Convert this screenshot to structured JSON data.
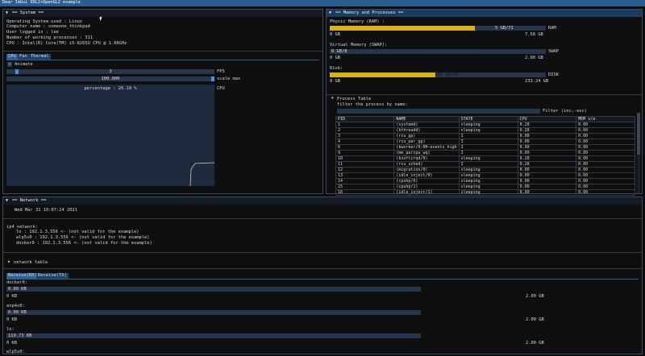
{
  "window_title": "Dear ImGui SDL2+OpenGL2 example",
  "system": {
    "header": "== System ==",
    "lines": [
      "Operating System used : Linux",
      "Computer name : someone_thinkpad",
      "User logged in : lee",
      "Number of working processes : 311",
      "CPU : Intel(R) Core(TM) i5-8265U CPU @ 1.60GHz"
    ],
    "tabs": [
      "CPU",
      "Fan",
      "Thermal"
    ],
    "animate_label": "Animate",
    "animate_checked": true,
    "fps_label": "FPS",
    "fps_value": "3",
    "scale_label": "scale max",
    "scale_value": "100.000",
    "plot_overlay": "percentage : 26.19 %",
    "plot_label": "CPU"
  },
  "memory": {
    "header": "== Memory and Processes ==",
    "ram": {
      "title": "Physic Memory (RAM) :",
      "bar_text": "5 GB/7I",
      "fraction": 0.67,
      "tag": "RAM",
      "min": "0 GB",
      "max": "7.58 GB"
    },
    "swap": {
      "title": "Virtual Memory (SWAP):",
      "bar_text": "0 GB/8",
      "fraction": 0.0,
      "tag": "SWAP",
      "min": "0 GB",
      "max": "2.00 GB"
    },
    "disk": {
      "title": "Disk:",
      "bar_text": "114 GB/46",
      "fraction": 0.49,
      "tag": "DISK",
      "min": "0 GB",
      "max": "233.24 GB"
    },
    "process_table_label": "Process Table",
    "filter_label": "filter the process by name:",
    "filter_hint": "Filter (inc,-exc)",
    "filter_value": "",
    "columns": [
      "PID",
      "NAME",
      "STATE",
      "CPU",
      "MEM v/a"
    ],
    "rows": [
      [
        "1",
        "(systemd)",
        "sleeping",
        "0.28",
        "0.00"
      ],
      [
        "2",
        "(kthreadd)",
        "sleeping",
        "0.28",
        "0.00"
      ],
      [
        "3",
        "(rcu_gp)",
        "I",
        "0.00",
        "0.00"
      ],
      [
        "4",
        "(rcu_par_gp)",
        "I",
        "0.00",
        "0.00"
      ],
      [
        "6",
        "(kworker/0:0H-events_high",
        "I",
        "0.00",
        "0.00"
      ],
      [
        "9",
        "(mm_percpu_wq)",
        "I",
        "0.00",
        "0.00"
      ],
      [
        "10",
        "(ksoftirqd/0)",
        "sleeping",
        "0.28",
        "0.00"
      ],
      [
        "11",
        "(rcu_sched)",
        "I",
        "0.28",
        "0.00"
      ],
      [
        "12",
        "(migration/0)",
        "sleeping",
        "0.00",
        "0.00"
      ],
      [
        "13",
        "(idle_inject/0)",
        "sleeping",
        "0.00",
        "0.00"
      ],
      [
        "14",
        "(cpuhp/0)",
        "sleeping",
        "0.00",
        "0.00"
      ],
      [
        "15",
        "(cpuhp/1)",
        "sleeping",
        "0.00",
        "0.00"
      ],
      [
        "16",
        "(idle_inject/1)",
        "sleeping",
        "0.00",
        "0.00"
      ]
    ]
  },
  "network": {
    "header": "== Network ==",
    "datetime": "Wed Mar 31 10:07:24 2021",
    "ipv4_label": "ip4 network:",
    "interfaces": [
      "lo : 192.1.3.556 <- (not valid for the example)",
      "wlp5s0 : 192.1.3.556 <- (not valid for the example)",
      "docker0 : 192.1.3.556 <- (not valid for the example)"
    ],
    "table_label": "network table",
    "tabs": [
      "Receive(RX)",
      "Receive(TX)"
    ],
    "rx": [
      {
        "name": "docker0:",
        "value": "0.00 KB",
        "min": "0 KB",
        "max": "2.00 GB"
      },
      {
        "name": "enp4s0:",
        "value": "0.00 KB",
        "min": "0 KB",
        "max": "2.00 GB"
      },
      {
        "name": "lo:",
        "value": "119.73 KB",
        "min": "0 KB",
        "max": "2.00 GB"
      }
    ],
    "wifi_label": "wlp5s0:"
  }
}
